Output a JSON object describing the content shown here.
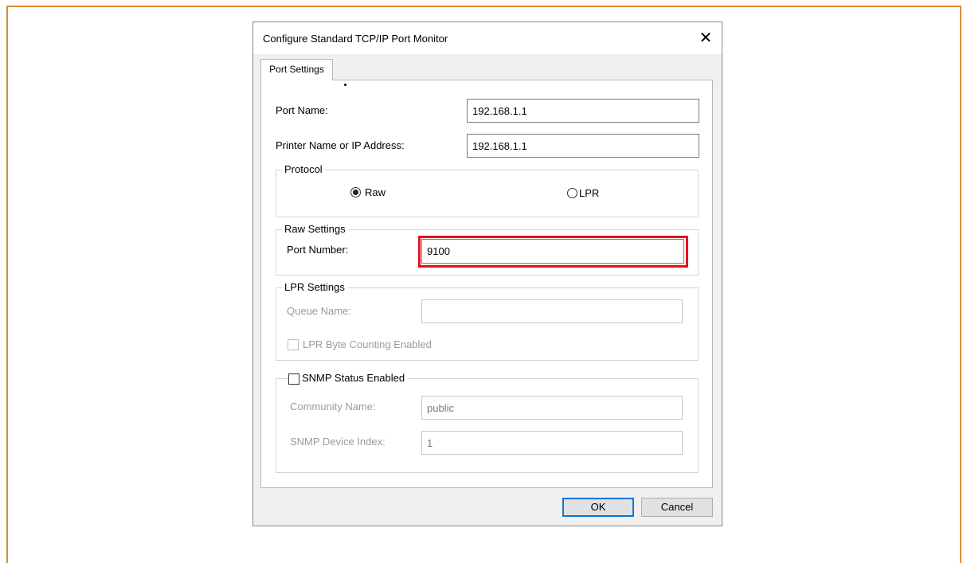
{
  "dialog": {
    "title": "Configure Standard TCP/IP Port Monitor",
    "close_symbol": "✕",
    "tab_label": "Port Settings"
  },
  "port": {
    "name_label": "Port Name:",
    "name_value": "192.168.1.1",
    "printer_label": "Printer Name or IP Address:",
    "printer_value": "192.168.1.1"
  },
  "protocol": {
    "legend": "Protocol",
    "raw_label": "Raw",
    "lpr_label": "LPR",
    "selected": "Raw"
  },
  "raw_settings": {
    "legend": "Raw Settings",
    "port_number_label": "Port Number:",
    "port_number_value": "9100"
  },
  "lpr_settings": {
    "legend": "LPR Settings",
    "queue_name_label": "Queue Name:",
    "queue_name_value": "",
    "byte_counting_label": "LPR Byte Counting Enabled",
    "byte_counting_checked": false
  },
  "snmp": {
    "enabled_label": "SNMP Status Enabled",
    "enabled_checked": false,
    "community_label": "Community Name:",
    "community_value": "public",
    "device_index_label": "SNMP Device Index:",
    "device_index_value": "1"
  },
  "buttons": {
    "ok": "OK",
    "cancel": "Cancel"
  },
  "colors": {
    "frame_border": "#d98c3a",
    "highlight": "#e8101c",
    "default_button_border": "#0078d7"
  }
}
